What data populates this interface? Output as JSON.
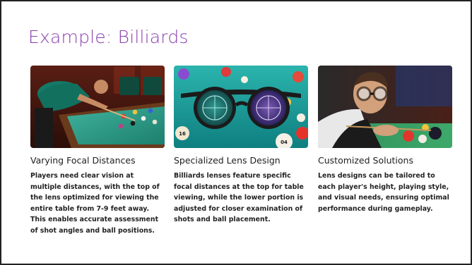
{
  "slide": {
    "title": "Example: Billiards",
    "title_color": "#8a3fae"
  },
  "cards": [
    {
      "heading": "Varying Focal Distances",
      "body": "Players need clear vision at multiple distances, with the top of the lens optimized for viewing the entire table from 7-9 feet away. This enables accurate assessment of shot angles and ball positions.",
      "image": "billiards-player-photo"
    },
    {
      "heading": "Specialized Lens Design",
      "body": "Billiards lenses feature specific focal distances at the top for table viewing, while the lower portion is adjusted for closer examination of shots and ball placement.",
      "image": "billiards-glasses-illustration",
      "ball_labels": [
        "16",
        "04"
      ]
    },
    {
      "heading": "Customized Solutions",
      "body": "Lens designs can be tailored to each player's height, playing style, and visual needs, ensuring optimal performance during gameplay.",
      "image": "player-with-glasses-photo"
    }
  ]
}
